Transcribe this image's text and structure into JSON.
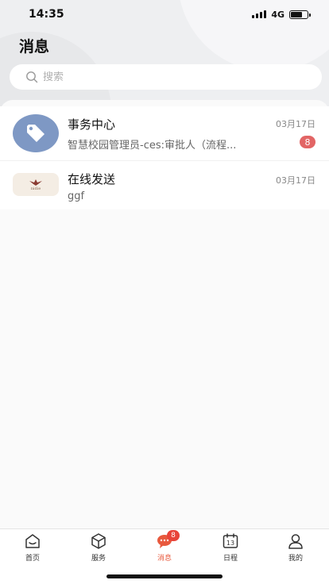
{
  "status_bar": {
    "time": "14:35",
    "network": "4G"
  },
  "page": {
    "title": "消息"
  },
  "search": {
    "placeholder": "搜索"
  },
  "messages": [
    {
      "title": "事务中心",
      "preview": "智慧校园管理员-ces:审批人（流程...",
      "date": "03月17日",
      "badge": "8",
      "avatar_icon": "tag-icon",
      "avatar_color": "#7e98c4"
    },
    {
      "title": "在线发送",
      "preview": "ggf",
      "date": "03月17日",
      "avatar_icon": "bird-logo",
      "avatar_text": "nidie"
    }
  ],
  "tabs": [
    {
      "label": "首页",
      "icon": "home-icon"
    },
    {
      "label": "服务",
      "icon": "cube-icon"
    },
    {
      "label": "消息",
      "icon": "chat-bubble-icon",
      "badge": "8",
      "active": true
    },
    {
      "label": "日程",
      "icon": "calendar-icon",
      "day": "13"
    },
    {
      "label": "我的",
      "icon": "person-icon"
    }
  ],
  "colors": {
    "accent": "#e8593d",
    "badge": "#e26565",
    "avatar": "#7e98c4"
  }
}
